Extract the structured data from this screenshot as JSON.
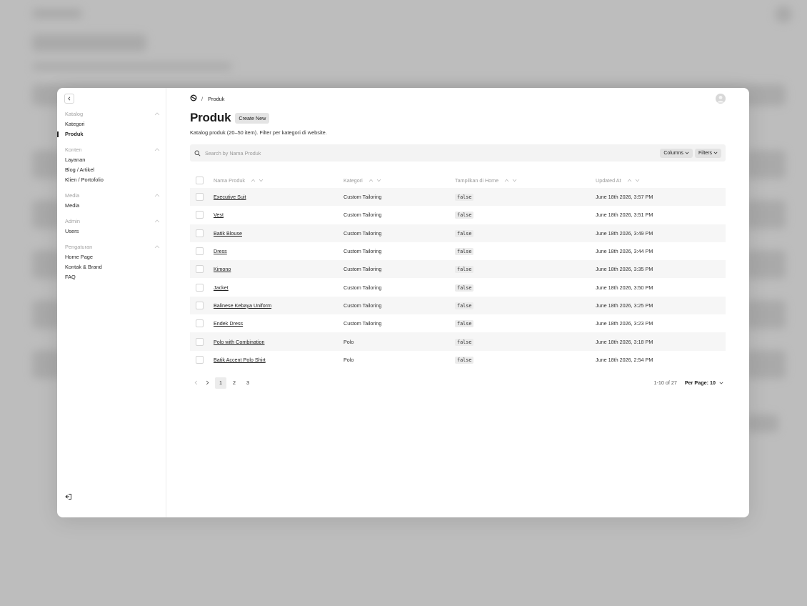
{
  "sidebar": {
    "groups": [
      {
        "label": "Katalog",
        "items": [
          "Kategori",
          "Produk"
        ]
      },
      {
        "label": "Konten",
        "items": [
          "Layanan",
          "Blog / Artikel",
          "Klien / Portofolio"
        ]
      },
      {
        "label": "Media",
        "items": [
          "Media"
        ]
      },
      {
        "label": "Admin",
        "items": [
          "Users"
        ]
      },
      {
        "label": "Pengaturan",
        "items": [
          "Home Page",
          "Kontak & Brand",
          "FAQ"
        ]
      }
    ],
    "active_item": "Produk"
  },
  "breadcrumb": {
    "separator": "/",
    "current": "Produk"
  },
  "page": {
    "title": "Produk",
    "create_label": "Create New",
    "description": "Katalog produk (20–50 item). Filter per kategori di website."
  },
  "search": {
    "placeholder": "Search by Nama Produk",
    "columns_label": "Columns",
    "filters_label": "Filters"
  },
  "table": {
    "headers": {
      "name": "Nama Produk",
      "category": "Kategori",
      "home": "Tampilkan di Home",
      "updated": "Updated At"
    },
    "rows": [
      {
        "name": "Executive Suit",
        "category": "Custom Tailoring",
        "home": "false",
        "updated": "June 18th 2026, 3:57 PM"
      },
      {
        "name": "Vest",
        "category": "Custom Tailoring",
        "home": "false",
        "updated": "June 18th 2026, 3:51 PM"
      },
      {
        "name": "Batik Blouse",
        "category": "Custom Tailoring",
        "home": "false",
        "updated": "June 18th 2026, 3:49 PM"
      },
      {
        "name": "Dress",
        "category": "Custom Tailoring",
        "home": "false",
        "updated": "June 18th 2026, 3:44 PM"
      },
      {
        "name": "Kimono",
        "category": "Custom Tailoring",
        "home": "false",
        "updated": "June 18th 2026, 3:35 PM"
      },
      {
        "name": "Jacket",
        "category": "Custom Tailoring",
        "home": "false",
        "updated": "June 18th 2026, 3:50 PM"
      },
      {
        "name": "Balinese Kebaya Uniform",
        "category": "Custom Tailoring",
        "home": "false",
        "updated": "June 18th 2026, 3:25 PM"
      },
      {
        "name": "Endek Dress",
        "category": "Custom Tailoring",
        "home": "false",
        "updated": "June 18th 2026, 3:23 PM"
      },
      {
        "name": "Polo with Combination",
        "category": "Polo",
        "home": "false",
        "updated": "June 18th 2026, 3:18 PM"
      },
      {
        "name": "Batik Accent Polo Shirt",
        "category": "Polo",
        "home": "false",
        "updated": "June 18th 2026, 2:54 PM"
      }
    ]
  },
  "pagination": {
    "pages": [
      "1",
      "2",
      "3"
    ],
    "current": "1",
    "range": "1-10 of 27",
    "per_page": "Per Page: 10"
  }
}
